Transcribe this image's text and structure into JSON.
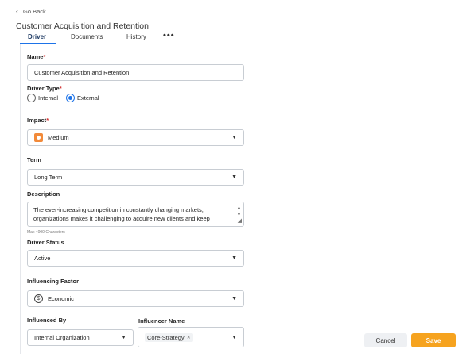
{
  "nav": {
    "back_label": "Go Back"
  },
  "page": {
    "title": "Customer Acquisition and Retention"
  },
  "tabs": [
    {
      "label": "Driver"
    },
    {
      "label": "Documents"
    },
    {
      "label": "History"
    }
  ],
  "form": {
    "name": {
      "label": "Name",
      "value": "Customer Acquisition and Retention"
    },
    "driver_type": {
      "label": "Driver Type",
      "options": [
        {
          "label": "Internal",
          "checked": false
        },
        {
          "label": "External",
          "checked": true
        }
      ]
    },
    "impact": {
      "label": "Impact",
      "value": "Medium",
      "icon": "medium-impact-icon"
    },
    "term": {
      "label": "Term",
      "value": "Long Term"
    },
    "description": {
      "label": "Description",
      "value": "The ever-increasing competition in constantly changing markets, organizations makes it challenging to acquire new clients and keep",
      "hint": "Max 4000 Characters"
    },
    "driver_status": {
      "label": "Driver Status",
      "value": "Active"
    },
    "influencing_factor": {
      "label": "Influencing Factor",
      "value": "Economic",
      "icon": "dollar-icon"
    },
    "influenced_by": {
      "label": "Influenced By",
      "value": "Internal Organization"
    },
    "influencer_name": {
      "label": "Influencer Name",
      "chip": "Core-Strategy"
    }
  },
  "actions": {
    "cancel_label": "Cancel",
    "save_label": "Save"
  },
  "colors": {
    "accent": "#1d73e8",
    "save": "#f6a31f",
    "impact": "#f28a3a",
    "required": "#d32f2f"
  }
}
